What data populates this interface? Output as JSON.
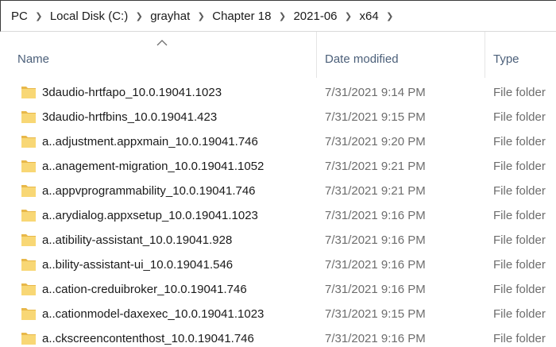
{
  "breadcrumb": [
    "PC",
    "Local Disk (C:)",
    "grayhat",
    "Chapter 18",
    "2021-06",
    "x64"
  ],
  "breadcrumb_separator_icon": "chevron-right-icon",
  "columns": {
    "name": "Name",
    "date_modified": "Date modified",
    "type": "Type"
  },
  "sort": {
    "column": "name",
    "indicator_icon": "sort-up-chevron-icon"
  },
  "rows": [
    {
      "name": "3daudio-hrtfapo_10.0.19041.1023",
      "date": "7/31/2021 9:14 PM",
      "type": "File folder"
    },
    {
      "name": "3daudio-hrtfbins_10.0.19041.423",
      "date": "7/31/2021 9:15 PM",
      "type": "File folder"
    },
    {
      "name": "a..adjustment.appxmain_10.0.19041.746",
      "date": "7/31/2021 9:20 PM",
      "type": "File folder"
    },
    {
      "name": "a..anagement-migration_10.0.19041.1052",
      "date": "7/31/2021 9:21 PM",
      "type": "File folder"
    },
    {
      "name": "a..appvprogrammability_10.0.19041.746",
      "date": "7/31/2021 9:21 PM",
      "type": "File folder"
    },
    {
      "name": "a..arydialog.appxsetup_10.0.19041.1023",
      "date": "7/31/2021 9:16 PM",
      "type": "File folder"
    },
    {
      "name": "a..atibility-assistant_10.0.19041.928",
      "date": "7/31/2021 9:16 PM",
      "type": "File folder"
    },
    {
      "name": "a..bility-assistant-ui_10.0.19041.546",
      "date": "7/31/2021 9:16 PM",
      "type": "File folder"
    },
    {
      "name": "a..cation-creduibroker_10.0.19041.746",
      "date": "7/31/2021 9:16 PM",
      "type": "File folder"
    },
    {
      "name": "a..cationmodel-daxexec_10.0.19041.1023",
      "date": "7/31/2021 9:15 PM",
      "type": "File folder"
    },
    {
      "name": "a..ckscreencontenthost_10.0.19041.746",
      "date": "7/31/2021 9:16 PM",
      "type": "File folder"
    }
  ],
  "colors": {
    "folder_fill": "#f8d775",
    "folder_back": "#e8b84a",
    "header_text": "#4c607a",
    "secondary_text": "#6d6d6d"
  }
}
